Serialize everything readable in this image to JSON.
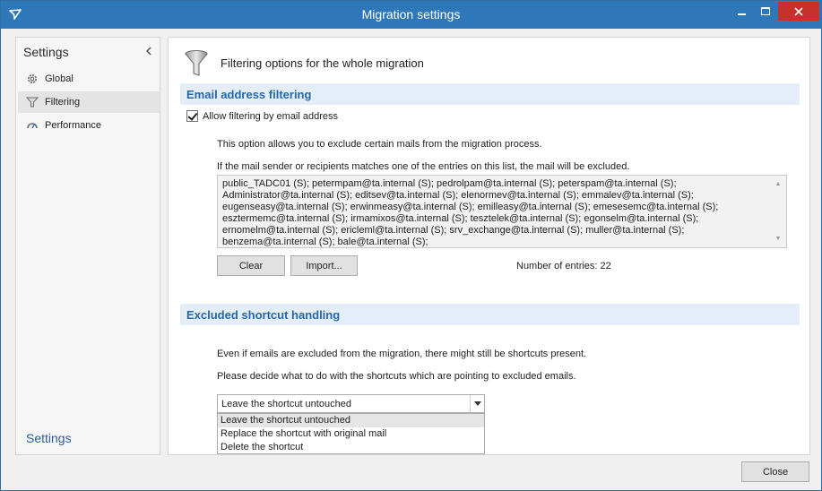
{
  "window": {
    "title": "Migration settings",
    "accent_color": "#2e77b8",
    "close_color": "#c7312b"
  },
  "sidebar": {
    "header": "Settings",
    "collapse_icon": "chevron-left-icon",
    "items": [
      {
        "label": "Global",
        "icon": "gear-icon",
        "active": false
      },
      {
        "label": "Filtering",
        "icon": "funnel-icon",
        "active": true
      },
      {
        "label": "Performance",
        "icon": "gauge-icon",
        "active": false
      }
    ],
    "footer": "Settings"
  },
  "main": {
    "page_title": "Filtering options for the whole migration",
    "email_section": {
      "heading": "Email address filtering",
      "checkbox_label": "Allow filtering by email address",
      "checkbox_checked": true,
      "description": "This option allows you to exclude certain mails from the migration process.",
      "hint": "If the mail sender or recipients matches one of the entries on this list, the mail will be excluded.",
      "entries_lines": [
        "public_TADC01 (S); petermpam@ta.internal (S); pedrolpam@ta.internal (S); peterspam@ta.internal (S);",
        "Administrator@ta.internal (S); editsev@ta.internal (S); elenormev@ta.internal (S); emmalev@ta.internal (S);",
        "eugenseasy@ta.internal (S); erwinmeasy@ta.internal (S); emilleasy@ta.internal (S); emesesemc@ta.internal (S);",
        "esztermemc@ta.internal (S); irmamixos@ta.internal (S); tesztelek@ta.internal (S); egonselm@ta.internal (S);",
        "ernomelm@ta.internal (S); ericleml@ta.internal (S); srv_exchange@ta.internal (S); muller@ta.internal (S);",
        "benzema@ta.internal (S); bale@ta.internal (S);"
      ],
      "clear_label": "Clear",
      "import_label": "Import...",
      "count_text": "Number of entries: 22"
    },
    "shortcut_section": {
      "heading": "Excluded shortcut handling",
      "description": "Even if emails are excluded from the migration, there might still be shortcuts present.",
      "question": "Please decide what to do with the shortcuts which are pointing to excluded emails.",
      "selected": "Leave the shortcut untouched",
      "options": [
        "Leave the shortcut untouched",
        "Replace the shortcut with original mail",
        "Delete the shortcut"
      ]
    }
  },
  "footer": {
    "close_label": "Close"
  }
}
